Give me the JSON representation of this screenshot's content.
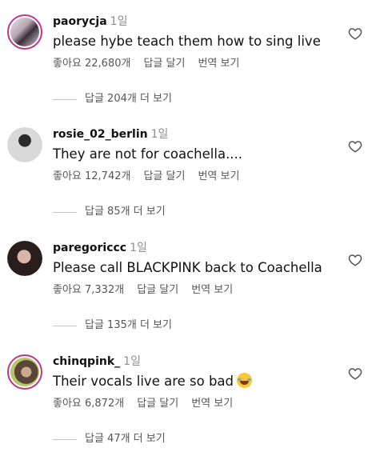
{
  "comments": [
    {
      "username": "paorycja",
      "time": "1일",
      "text": "please hybe teach them how to sing live",
      "likes": "좋아요 22,680개",
      "reply": "답글 달기",
      "translate": "번역 보기",
      "view_replies": "답글 204개 더 보기"
    },
    {
      "username": "rosie_02_berlin",
      "time": "1일",
      "text": "They are not for coachella....",
      "likes": "좋아요 12,742개",
      "reply": "답글 달기",
      "translate": "번역 보기",
      "view_replies": "답글 85개 더 보기"
    },
    {
      "username": "paregoriccc",
      "time": "1일",
      "text": "Please call BLACKPINK back to Coachella",
      "likes": "좋아요 7,332개",
      "reply": "답글 달기",
      "translate": "번역 보기",
      "view_replies": "답글 135개 더 보기"
    },
    {
      "username": "chinqpink_",
      "time": "1일",
      "text": "Their vocals live are so bad",
      "likes": "좋아요 6,872개",
      "reply": "답글 달기",
      "translate": "번역 보기",
      "view_replies": "답글 47개 더 보기",
      "emoji": "face-with-tears-of-joy-emoji"
    }
  ],
  "colors": {
    "username": "#111111",
    "meta": "#555555",
    "time": "#8e8e8e",
    "story_ring": "#c13584"
  }
}
